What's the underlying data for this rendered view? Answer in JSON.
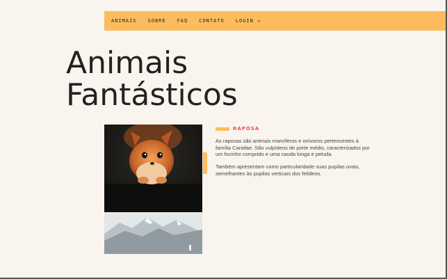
{
  "nav": {
    "items": [
      {
        "label": "ANIMAIS"
      },
      {
        "label": "SOBRE"
      },
      {
        "label": "FAQ"
      },
      {
        "label": "CONTATO"
      },
      {
        "label": "LOGIN →"
      }
    ]
  },
  "hero": {
    "title_line1": "Animais",
    "title_line2": "Fantásticos"
  },
  "gallery": {
    "images": [
      "squirrel-photo",
      "snowy-mountain-photo"
    ]
  },
  "article": {
    "tag": "RAPOSA",
    "paragraphs": [
      "As raposas são animais mamíferos e onívoros pertencentes à família Canidae. São vulpídeos de porte médio, caracterizados por um focinho comprido e uma cauda longa e peluda.",
      "Também apresentam como particularidade suas pupilas ovais, semelhantes às pupilas verticais dos felídeos."
    ]
  },
  "colors": {
    "accent": "#fcbc5d",
    "tag": "#e4514d",
    "background": "#f9f5ee",
    "text": "#222222"
  }
}
